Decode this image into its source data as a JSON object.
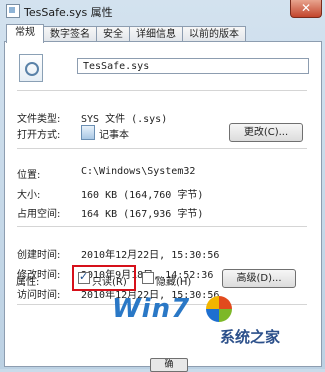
{
  "window": {
    "title": "TesSafe.sys 属性",
    "close_symbol": "✕"
  },
  "tabs": [
    "常规",
    "数字签名",
    "安全",
    "详细信息",
    "以前的版本"
  ],
  "general": {
    "file_name": "TesSafe.sys",
    "file_type_label": "文件类型:",
    "file_type_value": "SYS 文件 (.sys)",
    "open_with_label": "打开方式:",
    "open_with_value": "记事本",
    "change_button": "更改(C)...",
    "location_label": "位置:",
    "location_value": "C:\\Windows\\System32",
    "size_label": "大小:",
    "size_value": "160 KB (164,760 字节)",
    "disk_size_label": "占用空间:",
    "disk_size_value": "164 KB (167,936 字节)",
    "created_label": "创建时间:",
    "created_value": "2010年12月22日, 15:30:56",
    "modified_label": "修改时间:",
    "modified_value": "2010年9月18日, 14:52:36",
    "accessed_label": "访问时间:",
    "accessed_value": "2010年12月22日, 15:30:56",
    "attributes_label": "属性:",
    "readonly_label": "只读(R)",
    "readonly_checked": true,
    "hidden_label": "隐藏(H)",
    "hidden_checked": false,
    "advanced_button": "高级(D)..."
  },
  "watermark": {
    "brand": "Win7",
    "site": "系统之家"
  },
  "bottom": {
    "ok_button": "确"
  }
}
